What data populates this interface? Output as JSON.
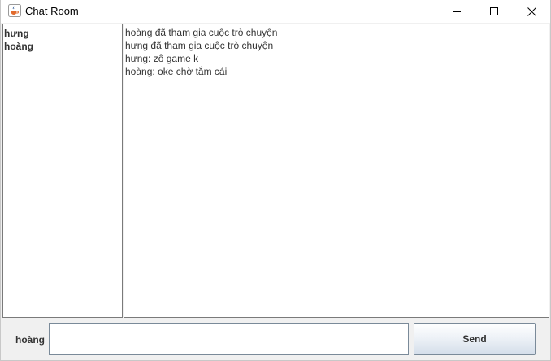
{
  "window": {
    "title": "Chat Room",
    "icon": "java-cup-icon"
  },
  "title_controls": {
    "minimize_icon": "minimize-icon",
    "maximize_icon": "maximize-icon",
    "close_icon": "close-icon"
  },
  "users": [
    {
      "name": "hưng"
    },
    {
      "name": "hoàng"
    }
  ],
  "messages": [
    {
      "text": "hoàng đã tham gia cuộc trò chuyện"
    },
    {
      "text": "hưng đã tham gia cuộc trò chuyện"
    },
    {
      "text": "hưng: zô game k"
    },
    {
      "text": "hoàng: oke chờ tắm cái"
    }
  ],
  "compose": {
    "username": "hoàng",
    "input_value": "",
    "send_label": "Send"
  },
  "colors": {
    "panel_border": "#7a7a7a",
    "text": "#333333",
    "window_bg": "#f0f0f0"
  }
}
